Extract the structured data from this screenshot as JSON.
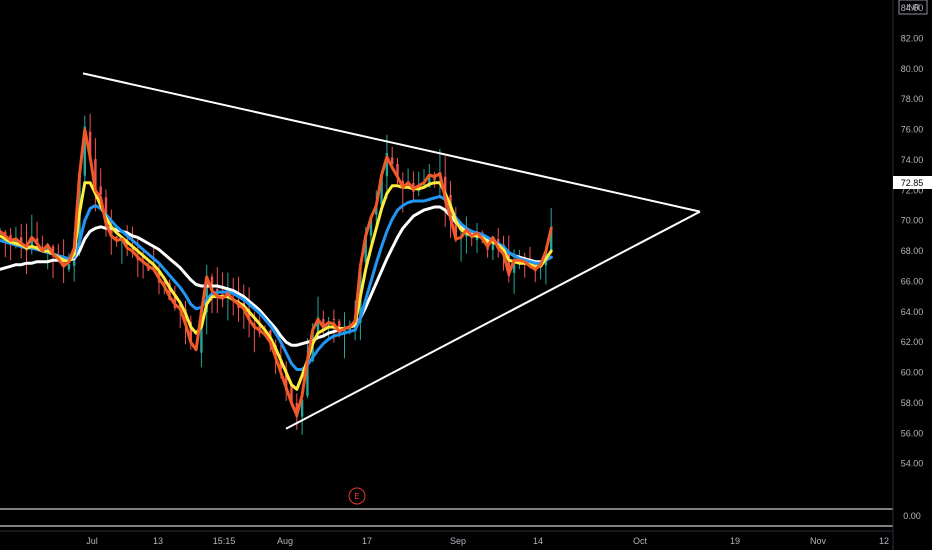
{
  "currency": "INR",
  "chart_data": {
    "type": "line",
    "ylim": [
      52.4,
      84.4
    ],
    "y_ticks": [
      "84.00",
      "82.00",
      "80.00",
      "78.00",
      "76.00",
      "74.00",
      "72.00",
      "70.00",
      "68.00",
      "66.00",
      "64.00",
      "62.00",
      "60.00",
      "58.00",
      "56.00",
      "54.00"
    ],
    "x_ticks": [
      "Jul",
      "13",
      "15:15",
      "Aug",
      "17",
      "Sep",
      "14",
      "Oct",
      "19",
      "Nov",
      "12"
    ],
    "last_price": "72.85",
    "volume_axis_label": "0.00",
    "event_marker": "E",
    "series": [
      {
        "values": [
          69.3,
          69.0,
          68.7,
          68.8,
          68.5,
          68.3,
          68.9,
          68.5,
          68.0,
          68.4,
          67.8,
          67.5,
          67.0,
          67.3,
          68.2,
          73.0,
          76.0,
          74.2,
          72.0,
          71.5,
          69.8,
          69.0,
          68.7,
          68.8,
          68.2,
          68.0,
          67.6,
          67.3,
          67.0,
          66.8,
          66.2,
          65.7,
          65.0,
          64.5,
          64.2,
          63.2,
          62.0,
          61.5,
          64.0,
          66.3,
          65.4,
          65.0,
          64.9,
          65.2,
          64.8,
          64.5,
          64.2,
          63.5,
          63.0,
          62.8,
          62.5,
          62.0,
          61.0,
          60.0,
          59.0,
          58.0,
          57.2,
          58.5,
          60.8,
          62.8,
          63.5,
          63.0,
          63.3,
          63.2,
          62.7,
          62.9,
          63.0,
          63.4,
          67.0,
          69.0,
          70.2,
          71.0,
          73.0,
          74.2,
          73.5,
          72.9,
          72.2,
          72.5,
          72.1,
          72.3,
          72.5,
          73.0,
          72.9,
          73.1,
          71.5,
          70.2,
          68.8,
          68.9,
          69.4,
          69.0,
          69.2,
          68.8,
          68.3,
          68.9,
          68.2,
          67.8,
          66.5,
          67.4,
          67.4,
          67.3,
          67.0,
          66.8,
          67.1,
          68.0,
          69.5
        ]
      },
      {
        "values": [
          69.0,
          68.8,
          68.6,
          68.5,
          68.4,
          68.2,
          68.3,
          68.2,
          68.0,
          68.0,
          67.8,
          67.6,
          67.4,
          67.3,
          67.8,
          70.5,
          72.5,
          72.5,
          71.8,
          71.0,
          70.2,
          69.6,
          69.2,
          68.9,
          68.6,
          68.3,
          68.0,
          67.7,
          67.4,
          67.1,
          66.7,
          66.2,
          65.6,
          65.1,
          64.6,
          63.9,
          63.0,
          62.6,
          63.0,
          64.5,
          65.0,
          65.0,
          65.0,
          65.0,
          64.8,
          64.6,
          64.4,
          64.0,
          63.6,
          63.2,
          62.8,
          62.3,
          61.6,
          60.8,
          60.0,
          59.2,
          58.9,
          59.8,
          60.8,
          61.9,
          62.6,
          62.8,
          63.0,
          63.0,
          62.9,
          62.9,
          63.0,
          63.2,
          65.0,
          66.8,
          68.2,
          69.5,
          70.8,
          71.8,
          72.3,
          72.3,
          72.2,
          72.2,
          72.1,
          72.1,
          72.2,
          72.4,
          72.5,
          72.5,
          71.8,
          71.0,
          70.0,
          69.4,
          69.2,
          69.0,
          69.0,
          68.9,
          68.6,
          68.6,
          68.4,
          68.1,
          67.4,
          67.3,
          67.2,
          67.2,
          67.1,
          67.0,
          67.0,
          67.5,
          68.0
        ]
      },
      {
        "values": [
          68.7,
          68.6,
          68.5,
          68.4,
          68.3,
          68.2,
          68.2,
          68.1,
          68.0,
          67.9,
          67.8,
          67.7,
          67.6,
          67.5,
          67.6,
          68.6,
          70.0,
          70.8,
          71.0,
          70.8,
          70.4,
          70.0,
          69.6,
          69.3,
          69.0,
          68.7,
          68.4,
          68.1,
          67.8,
          67.5,
          67.2,
          66.8,
          66.4,
          66.0,
          65.6,
          65.1,
          64.5,
          64.2,
          64.3,
          64.8,
          65.2,
          65.3,
          65.3,
          65.3,
          65.2,
          65.0,
          64.8,
          64.5,
          64.2,
          63.9,
          63.5,
          63.1,
          62.6,
          62.0,
          61.3,
          60.6,
          60.2,
          60.2,
          60.5,
          61.0,
          61.5,
          61.9,
          62.2,
          62.4,
          62.5,
          62.6,
          62.7,
          62.8,
          63.6,
          64.8,
          66.0,
          67.2,
          68.3,
          69.3,
          70.1,
          70.7,
          71.0,
          71.2,
          71.3,
          71.3,
          71.3,
          71.4,
          71.5,
          71.6,
          71.4,
          70.9,
          70.2,
          69.8,
          69.5,
          69.3,
          69.2,
          69.1,
          68.9,
          68.7,
          68.5,
          68.3,
          67.9,
          67.7,
          67.5,
          67.4,
          67.3,
          67.2,
          67.2,
          67.4,
          67.6
        ]
      },
      {
        "values": [
          66.8,
          66.9,
          67.0,
          67.1,
          67.1,
          67.2,
          67.2,
          67.3,
          67.3,
          67.3,
          67.4,
          67.4,
          67.4,
          67.4,
          67.5,
          68.0,
          68.8,
          69.3,
          69.5,
          69.6,
          69.5,
          69.5,
          69.4,
          69.3,
          69.2,
          69.0,
          68.9,
          68.7,
          68.5,
          68.3,
          68.1,
          67.8,
          67.5,
          67.2,
          66.9,
          66.5,
          66.1,
          65.8,
          65.7,
          65.7,
          65.7,
          65.7,
          65.6,
          65.5,
          65.4,
          65.2,
          65.0,
          64.7,
          64.4,
          64.1,
          63.7,
          63.3,
          62.9,
          62.4,
          62.0,
          61.8,
          61.8,
          61.9,
          62.0,
          62.1,
          62.3,
          62.4,
          62.6,
          62.7,
          62.8,
          62.9,
          63.0,
          63.1,
          63.6,
          64.3,
          65.1,
          65.9,
          66.7,
          67.5,
          68.2,
          68.9,
          69.5,
          69.9,
          70.3,
          70.5,
          70.7,
          70.8,
          70.9,
          70.9,
          70.7,
          70.3,
          69.9,
          69.6,
          69.4,
          69.2,
          69.1,
          69.0,
          68.8,
          68.6,
          68.4,
          68.2,
          67.9,
          67.7,
          67.6,
          67.5,
          67.4,
          67.3,
          67.3,
          67.4,
          67.6
        ]
      }
    ],
    "trendlines": [
      {
        "from": {
          "date": "Jun 30",
          "price": 79.7
        },
        "to": {
          "date": "Oct 11",
          "price": 70.6
        }
      },
      {
        "from": {
          "date": "Aug 1",
          "price": 56.3
        },
        "to": {
          "date": "Oct 11",
          "price": 70.6
        }
      }
    ]
  },
  "colors": {
    "background": "#000000",
    "up_candle": "#26a69a",
    "down_candle": "#ef5350",
    "ma_fast": "#f05a28",
    "ma_mid": "#ffeb3b",
    "ma_slow": "#2196f3",
    "ma_long": "#ffffff",
    "trendline": "#ffffff",
    "axis_text": "#b2b5be",
    "last_price_bg": "#ffffff"
  }
}
